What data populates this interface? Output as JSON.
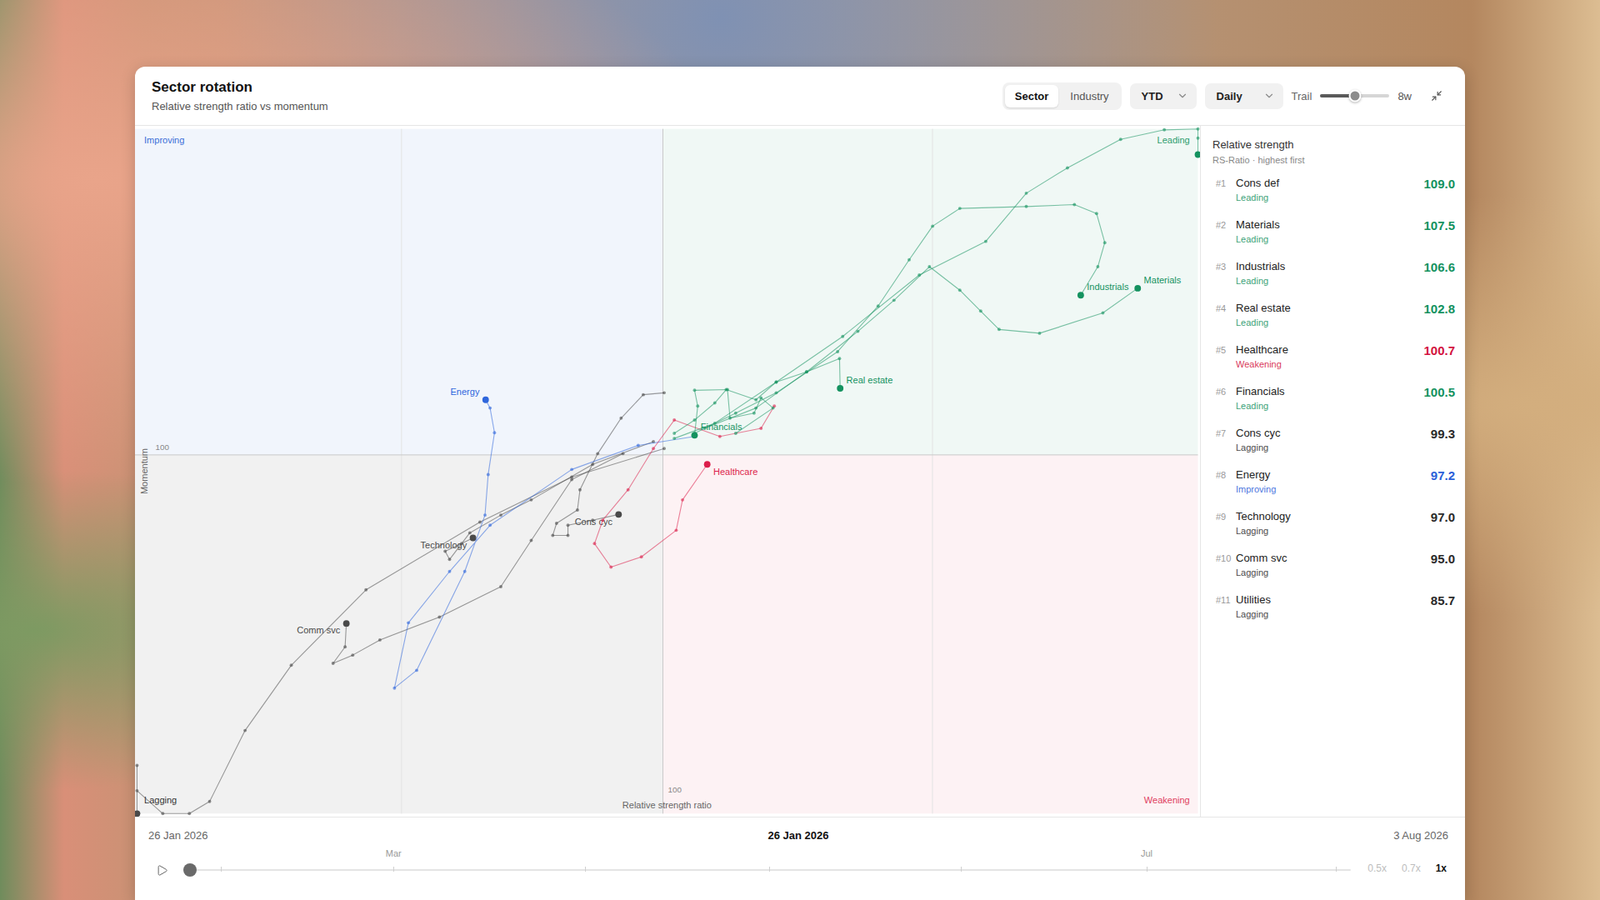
{
  "card": {
    "title": "Sector rotation",
    "subtitle": "Relative strength ratio vs momentum"
  },
  "toolbar": {
    "view_tabs": [
      {
        "label": "Sector",
        "selected": true
      },
      {
        "label": "Industry",
        "selected": false
      }
    ],
    "period": {
      "value": "YTD"
    },
    "interval": {
      "value": "Daily"
    },
    "trail": {
      "label": "Trail",
      "level": 0.5,
      "reading": "8w"
    }
  },
  "chart": {
    "quadrants": [
      {
        "label": "Improving",
        "color": "#3b6fd8"
      },
      {
        "label": "Leading",
        "color": "#2e9d6e"
      },
      {
        "label": "Lagging",
        "color": "#333333"
      },
      {
        "label": "Weakening",
        "color": "#e0405e"
      }
    ],
    "x_axis": {
      "title": "Relative strength ratio",
      "tick": "100"
    },
    "y_axis": {
      "title": "Momentum",
      "tick": "100"
    },
    "series": [
      {
        "color": "#4a4a4a",
        "rs": [
          100.02,
          98.56,
          97.11,
          95.31,
          94.13,
          93.4,
          92.84,
          92.52,
          92.1,
          90.5,
          89.0,
          85.7
        ],
        "momentum": [
          100.1,
          99.65,
          98.94,
          97.87,
          96.68,
          95.65,
          94.53,
          93.9,
          93.5,
          94.7,
          95.1,
          92.0
        ]
      },
      {
        "label": "Comm svc",
        "color": "#4a4a4a",
        "rs": [
          99.37,
          98.56,
          97.92,
          97.44,
          96.47,
          95.53,
          95.1,
          94.79,
          94.98,
          95.0
        ],
        "momentum": [
          100.02,
          99.61,
          98.65,
          97.92,
          97.44,
          97.08,
          96.84,
          96.71,
          96.97,
          97.34
        ]
      },
      {
        "label": "Technology",
        "color": "#4a4a4a",
        "rs": [
          99.85,
          98.89,
          97.92,
          97.44,
          96.95,
          96.63,
          96.56,
          96.82,
          97.0
        ],
        "momentum": [
          100.21,
          99.85,
          99.29,
          99.05,
          98.77,
          98.35,
          98.48,
          98.6,
          98.69
        ]
      },
      {
        "label": "Cons cyc",
        "color": "#4a4a4a",
        "rs": [
          100.02,
          99.69,
          99.34,
          98.97,
          98.69,
          98.65,
          98.32,
          98.26,
          98.5,
          98.5,
          98.89,
          99.3
        ],
        "momentum": [
          100.98,
          100.95,
          100.58,
          100.02,
          99.45,
          99.13,
          98.92,
          98.73,
          98.73,
          98.89,
          98.97,
          99.06
        ]
      },
      {
        "label": "Energy",
        "color": "#2f66dc",
        "rs": [
          100.5,
          99.61,
          98.56,
          97.27,
          96.63,
          95.98,
          95.76,
          96.11,
          96.87,
          97.19,
          97.24,
          97.34,
          97.27,
          97.2
        ],
        "momentum": [
          100.29,
          100.15,
          99.77,
          98.89,
          98.16,
          97.35,
          96.32,
          96.6,
          98.16,
          99.05,
          99.69,
          100.35,
          100.74,
          100.87
        ]
      },
      {
        "label": "Healthcare",
        "color": "#dc1f4b",
        "rs": [
          101.76,
          101.55,
          100.9,
          100.18,
          99.85,
          99.45,
          99.05,
          98.92,
          99.18,
          99.66,
          100.21,
          100.31,
          100.7
        ],
        "momentum": [
          100.77,
          100.42,
          100.29,
          100.55,
          100.1,
          99.45,
          98.97,
          98.6,
          98.23,
          98.39,
          98.81,
          99.29,
          99.85
        ]
      },
      {
        "label": "Financials",
        "color": "#14925f",
        "rs": [
          101.15,
          101.74,
          101.55,
          101.44,
          101.06,
          101.02,
          100.5,
          100.55,
          100.5
        ],
        "momentum": [
          100.34,
          100.74,
          100.9,
          100.66,
          100.58,
          101.03,
          101.02,
          100.77,
          100.31
        ]
      },
      {
        "label": "Real estate",
        "color": "#14925f",
        "rs": [
          100.18,
          100.5,
          100.82,
          101.0,
          101.47,
          101.79,
          102.27,
          102.79,
          102.8
        ],
        "momentum": [
          100.34,
          100.55,
          100.82,
          101.03,
          100.87,
          101.15,
          101.31,
          101.52,
          101.05
        ]
      },
      {
        "label": "Industrials",
        "color": "#14925f",
        "rs": [
          100.5,
          101.15,
          101.79,
          102.76,
          103.4,
          103.89,
          104.26,
          104.69,
          105.74,
          106.5,
          106.85,
          106.98,
          106.87,
          106.6
        ],
        "momentum": [
          100.34,
          100.66,
          100.98,
          101.63,
          102.35,
          103.08,
          103.61,
          103.89,
          103.92,
          103.95,
          103.81,
          103.35,
          102.97,
          102.52
        ]
      },
      {
        "label": "Materials",
        "color": "#14925f",
        "rs": [
          100.66,
          101.47,
          102.27,
          103.08,
          103.65,
          104.21,
          104.69,
          105.02,
          105.31,
          105.95,
          106.95,
          107.5
        ],
        "momentum": [
          100.42,
          100.74,
          101.31,
          101.95,
          102.44,
          102.97,
          102.6,
          102.27,
          101.98,
          101.92,
          102.24,
          102.63
        ]
      },
      {
        "color": "#14925f",
        "rs": [
          100.18,
          100.82,
          101.79,
          102.84,
          104.05,
          105.1,
          105.74,
          106.39,
          107.23,
          107.92,
          108.5,
          108.8,
          109.0
        ],
        "momentum": [
          100.26,
          100.5,
          101.15,
          101.87,
          102.84,
          103.37,
          104.13,
          104.53,
          104.98,
          105.13,
          105.3,
          105.0,
          104.74
        ]
      }
    ]
  },
  "sidebar": {
    "title": "Relative strength",
    "subtitle": "RS-Ratio · highest first",
    "items": [
      {
        "rank": "#1",
        "name": "Cons def",
        "status": "Leading",
        "value": "109.0",
        "color": "#14925f"
      },
      {
        "rank": "#2",
        "name": "Materials",
        "status": "Leading",
        "value": "107.5",
        "color": "#14925f"
      },
      {
        "rank": "#3",
        "name": "Industrials",
        "status": "Leading",
        "value": "106.6",
        "color": "#14925f"
      },
      {
        "rank": "#4",
        "name": "Real estate",
        "status": "Leading",
        "value": "102.8",
        "color": "#14925f"
      },
      {
        "rank": "#5",
        "name": "Healthcare",
        "status": "Weakening",
        "value": "100.7",
        "color": "#d3123e"
      },
      {
        "rank": "#6",
        "name": "Financials",
        "status": "Leading",
        "value": "100.5",
        "color": "#14925f"
      },
      {
        "rank": "#7",
        "name": "Cons cyc",
        "status": "Lagging",
        "value": "99.3",
        "color": "#2a2a2a"
      },
      {
        "rank": "#8",
        "name": "Energy",
        "status": "Improving",
        "value": "97.2",
        "color": "#2b5fd9"
      },
      {
        "rank": "#9",
        "name": "Technology",
        "status": "Lagging",
        "value": "97.0",
        "color": "#2a2a2a"
      },
      {
        "rank": "#10",
        "name": "Comm svc",
        "status": "Lagging",
        "value": "95.0",
        "color": "#2a2a2a"
      },
      {
        "rank": "#11",
        "name": "Utilities",
        "status": "Lagging",
        "value": "85.7",
        "color": "#2a2a2a"
      }
    ]
  },
  "timeline": {
    "start": "26 Jan 2026",
    "current": "26 Jan 2026",
    "end": "3 Aug 2026",
    "level": 0,
    "ticks": [
      {
        "label": "",
        "at": 0.032
      },
      {
        "label": "Mar",
        "at": 0.18
      },
      {
        "label": "",
        "at": 0.344
      },
      {
        "label": "",
        "at": 0.502
      },
      {
        "label": "",
        "at": 0.666
      },
      {
        "label": "Jul",
        "at": 0.825
      },
      {
        "label": "",
        "at": 0.987
      }
    ],
    "speeds": [
      {
        "label": "0.5x",
        "selected": false
      },
      {
        "label": "0.7x",
        "selected": false
      },
      {
        "label": "1x",
        "selected": true
      }
    ]
  }
}
